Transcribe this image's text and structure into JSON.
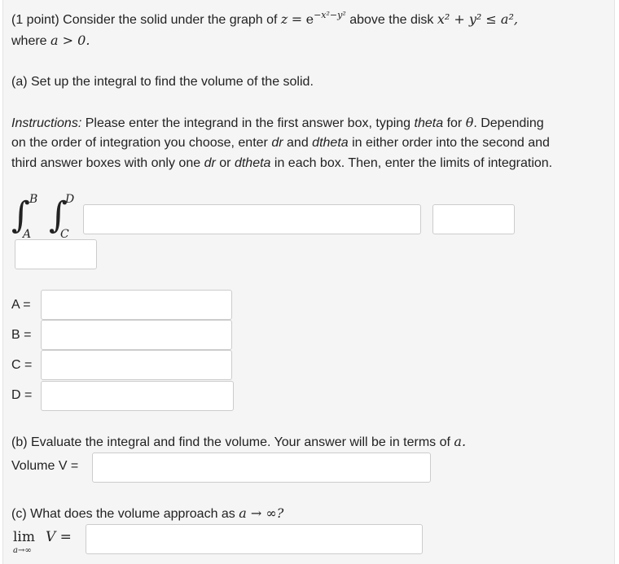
{
  "intro": {
    "prefix": "(1 point) Consider the solid under the graph of",
    "func_lhs": "z",
    "func_eq": "=",
    "func_base": "e",
    "func_exp": "−x²−y²",
    "mid": "above the disk",
    "disk": "x² + y² ≤ a²,",
    "where": "where",
    "cond": "a > 0."
  },
  "part_a": {
    "heading": "(a) Set up the integral to find the volume of the solid.",
    "instructions_label": "Instructions:",
    "instr_1": "Please enter the integrand in the first answer box, typing",
    "instr_theta_word": "theta",
    "instr_for": "for",
    "instr_theta_sym": "θ",
    "instr_2": ". Depending",
    "instr_line2a": "on the order of integration you choose, enter",
    "instr_dr": "dr",
    "instr_and": "and",
    "instr_dtheta": "dtheta",
    "instr_line2b": "in either order into the second and",
    "instr_line3a": "third answer boxes with only one",
    "instr_dr2": "dr",
    "instr_or": "or",
    "instr_dtheta2": "dtheta",
    "instr_line3b": "in each box. Then, enter the limits of integration.",
    "integral": {
      "upper_outer": "B",
      "lower_outer": "A",
      "upper_inner": "D",
      "lower_inner": "C",
      "sign": "∫"
    },
    "limits": [
      {
        "label": "A =",
        "value": ""
      },
      {
        "label": "B =",
        "value": ""
      },
      {
        "label": "C =",
        "value": ""
      },
      {
        "label": "D =",
        "value": ""
      }
    ],
    "integrand_value": "",
    "diff1_value": "",
    "diff2_value": ""
  },
  "part_b": {
    "heading": "(b) Evaluate the integral and find the volume. Your answer will be in terms of",
    "heading_var": "a.",
    "volume_label": "Volume V =",
    "volume_value": ""
  },
  "part_c": {
    "heading": "(c) What does the volume approach as",
    "heading_math": "a → ∞?",
    "lim": "lim",
    "lim_sub": "a→∞",
    "lim_rhs": "V =",
    "value": ""
  }
}
